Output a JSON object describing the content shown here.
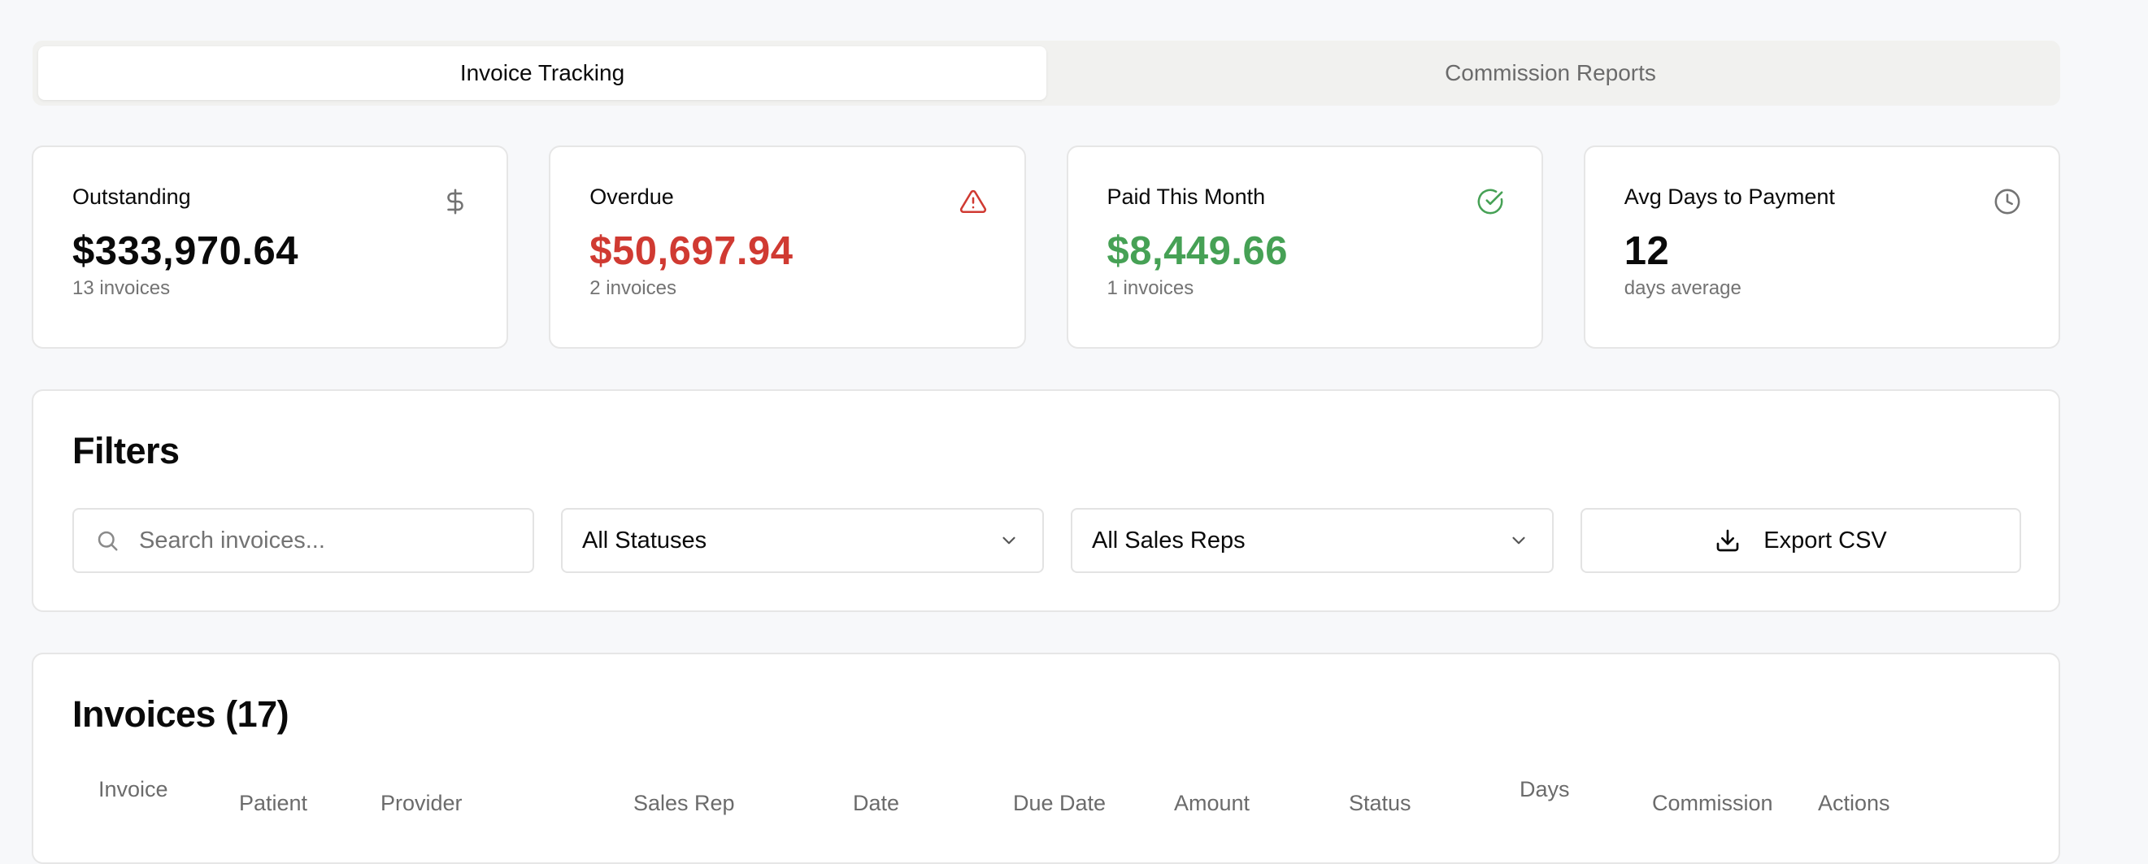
{
  "tabs": [
    {
      "label": "Invoice Tracking",
      "active": true
    },
    {
      "label": "Commission Reports",
      "active": false
    }
  ],
  "stats": [
    {
      "title": "Outstanding",
      "value": "$333,970.64",
      "sub": "13 invoices",
      "icon": "dollar-icon",
      "color": "#0a0a0a"
    },
    {
      "title": "Overdue",
      "value": "$50,697.94",
      "sub": "2 invoices",
      "icon": "alert-triangle-icon",
      "color": "#d03a32"
    },
    {
      "title": "Paid This Month",
      "value": "$8,449.66",
      "sub": "1 invoices",
      "icon": "check-circle-icon",
      "color": "#46a155"
    },
    {
      "title": "Avg Days to Payment",
      "value": "12",
      "sub": "days average",
      "icon": "clock-icon",
      "color": "#0a0a0a"
    }
  ],
  "filters": {
    "title": "Filters",
    "search_placeholder": "Search invoices...",
    "status_select": "All Statuses",
    "rep_select": "All Sales Reps",
    "export_label": "Export CSV"
  },
  "invoices": {
    "title": "Invoices (17)",
    "columns": [
      "Invoice",
      "Patient",
      "Provider",
      "Sales Rep",
      "Date",
      "Due Date",
      "Amount",
      "Status",
      "Days",
      "Commission",
      "Actions"
    ]
  }
}
